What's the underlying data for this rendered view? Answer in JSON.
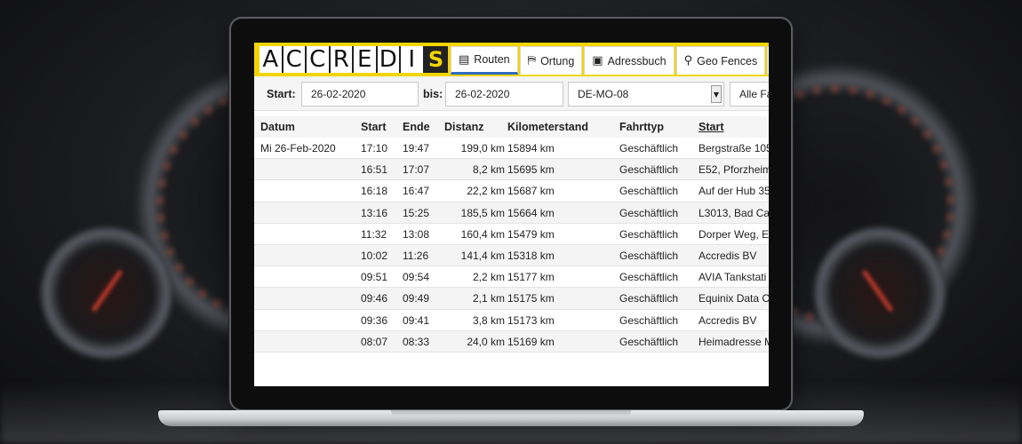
{
  "app": {
    "logo_letters": [
      "A",
      "C",
      "C",
      "R",
      "E",
      "D",
      "I"
    ],
    "logo_mark": "S",
    "accent_color": "#f2d500",
    "active_tab_color": "#2f6bbf"
  },
  "tabs": [
    {
      "label": "Routen",
      "icon": "list-icon",
      "glyph": "▤",
      "active": true
    },
    {
      "label": "Ortung",
      "icon": "map-icon",
      "glyph": "⛿",
      "active": false
    },
    {
      "label": "Adressbuch",
      "icon": "address-book-icon",
      "glyph": "▣",
      "active": false
    },
    {
      "label": "Geo Fences",
      "icon": "location-pin-icon",
      "glyph": "⚲",
      "active": false
    },
    {
      "label": "",
      "icon": "bell-icon",
      "glyph": "🔔",
      "active": false
    }
  ],
  "filter": {
    "start_label": "Start:",
    "start_value": "26-02-2020",
    "bis_label": "bis:",
    "bis_value": "26-02-2020",
    "vehicle_value": "DE-MO-08",
    "type_value": "Alle Fa"
  },
  "table": {
    "headers": {
      "datum": "Datum",
      "start": "Start",
      "ende": "Ende",
      "distanz": "Distanz",
      "kilometerstand": "Kilometerstand",
      "fahrttyp": "Fahrttyp",
      "start_addr": "Start"
    },
    "rows": [
      {
        "datum": "Mi 26-Feb-2020",
        "start": "17:10",
        "ende": "19:47",
        "distanz": "199,0 km",
        "km": "15894 km",
        "typ": "Geschäftlich",
        "addr": "Bergstraße 105"
      },
      {
        "datum": "",
        "start": "16:51",
        "ende": "17:07",
        "distanz": "8,2 km",
        "km": "15695 km",
        "typ": "Geschäftlich",
        "addr": "E52, Pforzheim"
      },
      {
        "datum": "",
        "start": "16:18",
        "ende": "16:47",
        "distanz": "22,2 km",
        "km": "15687 km",
        "typ": "Geschäftlich",
        "addr": "Auf der Hub 35"
      },
      {
        "datum": "",
        "start": "13:16",
        "ende": "15:25",
        "distanz": "185,5 km",
        "km": "15664 km",
        "typ": "Geschäftlich",
        "addr": "L3013, Bad Ca"
      },
      {
        "datum": "",
        "start": "11:32",
        "ende": "13:08",
        "distanz": "160,4 km",
        "km": "15479 km",
        "typ": "Geschäftlich",
        "addr": "Dorper Weg, E"
      },
      {
        "datum": "",
        "start": "10:02",
        "ende": "11:26",
        "distanz": "141,4 km",
        "km": "15318 km",
        "typ": "Geschäftlich",
        "addr": "Accredis BV"
      },
      {
        "datum": "",
        "start": "09:51",
        "ende": "09:54",
        "distanz": "2,2 km",
        "km": "15177 km",
        "typ": "Geschäftlich",
        "addr": "AVIA Tankstati"
      },
      {
        "datum": "",
        "start": "09:46",
        "ende": "09:49",
        "distanz": "2,1 km",
        "km": "15175 km",
        "typ": "Geschäftlich",
        "addr": "Equinix Data C"
      },
      {
        "datum": "",
        "start": "09:36",
        "ende": "09:41",
        "distanz": "3,8 km",
        "km": "15173 km",
        "typ": "Geschäftlich",
        "addr": "Accredis BV"
      },
      {
        "datum": "",
        "start": "08:07",
        "ende": "08:33",
        "distanz": "24,0 km",
        "km": "15169 km",
        "typ": "Geschäftlich",
        "addr": "Heimadresse M"
      }
    ]
  }
}
